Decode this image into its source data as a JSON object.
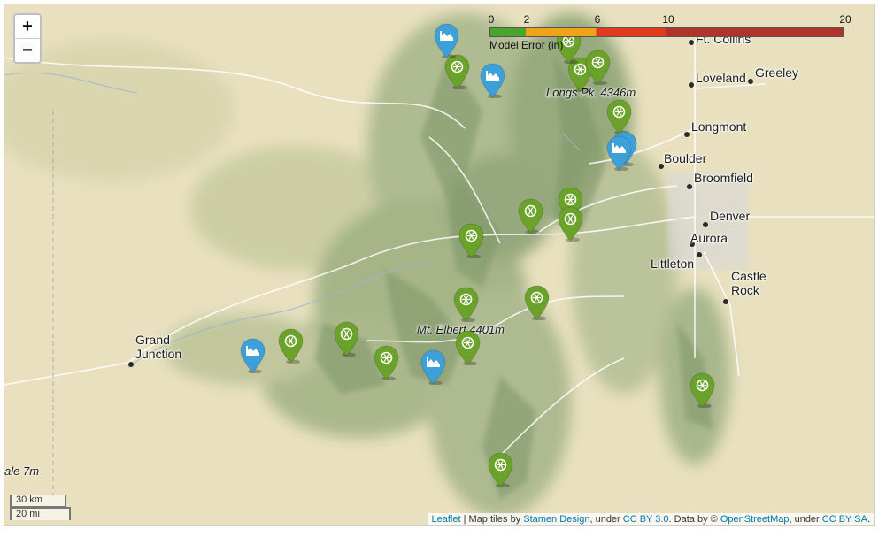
{
  "zoom_controls": {
    "zoom_in": "+",
    "zoom_out": "−"
  },
  "legend": {
    "title": "Model Error (in)",
    "ticks": [
      "0",
      "2",
      "6",
      "10",
      "20"
    ],
    "color_stops": [
      {
        "from": 0,
        "to": 2,
        "color": "#4aa52e"
      },
      {
        "from": 2,
        "to": 6,
        "color": "#f0a31a"
      },
      {
        "from": 6,
        "to": 10,
        "color": "#e23a1c"
      },
      {
        "from": 10,
        "to": 20,
        "color": "#b1342c"
      }
    ]
  },
  "cities": [
    {
      "name": "Ft. Collins"
    },
    {
      "name": "Loveland"
    },
    {
      "name": "Greeley"
    },
    {
      "name": "Longmont"
    },
    {
      "name": "Boulder"
    },
    {
      "name": "Broomfield"
    },
    {
      "name": "Denver"
    },
    {
      "name": "Aurora"
    },
    {
      "name": "Littleton"
    },
    {
      "name": "Castle\nRock"
    },
    {
      "name": "Grand\nJunction"
    }
  ],
  "peaks": [
    {
      "name": "Longs Pk.\n4346m"
    },
    {
      "name": "Mt. Elbert\n4401m"
    },
    {
      "name": "ale\n7m"
    }
  ],
  "marker_types": {
    "station": {
      "icon": "snowflake-wheel-icon",
      "color": "#6aa22a"
    },
    "chart": {
      "icon": "mountain-chart-icon",
      "color": "#3da0d8"
    }
  },
  "marker_count": {
    "station": 21,
    "chart": 6
  },
  "scale": {
    "km": "30 km",
    "mi": "20 mi"
  },
  "attribution": {
    "leaflet": "Leaflet",
    "sep1": " | Map tiles by ",
    "stamen": "Stamen Design",
    "sep2": ", under ",
    "cc1": "CC BY 3.0",
    "sep3": ". Data by © ",
    "osm": "OpenStreetMap",
    "sep4": ", under ",
    "cc2": "CC BY SA",
    "end": "."
  }
}
